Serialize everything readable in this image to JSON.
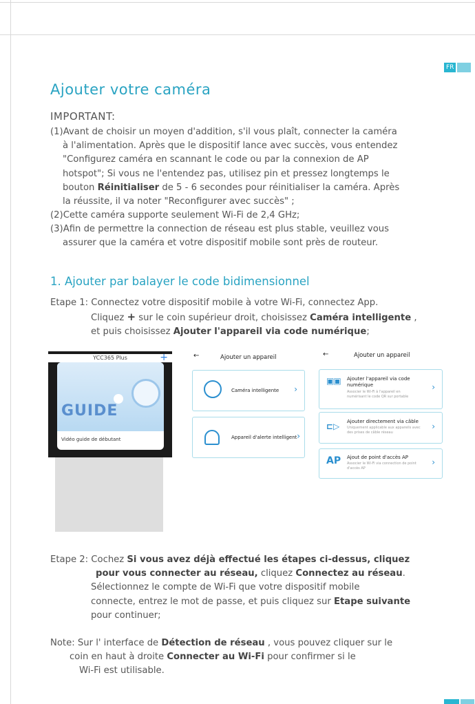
{
  "lang_badge": "FR",
  "title": "Ajouter votre caméra",
  "important_label": "IMPORTANT:",
  "items": {
    "i1": {
      "num": "(1)",
      "line1": "Avant de choisir un moyen d'addition, s'il vous plaît, connecter la caméra",
      "line2": "à l'alimentation. Après que le dispositif lance avec succès, vous entendez",
      "line3": "\"Configurez caméra en scannant le code ou par la connexion de AP",
      "line4": "hotspot\"; Si vous ne l'entendez pas, utilisez pin et pressez longtemps le",
      "line5_a": "bouton ",
      "line5_b": "Réinitialiser",
      "line5_c": " de 5 - 6 secondes pour réinitialiser la caméra. Après",
      "line6": "la réussite, il va noter \"Reconfigurer avec succès\" ;"
    },
    "i2": {
      "num": "(2)",
      "text": "Cette caméra supporte seulement Wi-Fi de 2,4 GHz;"
    },
    "i3": {
      "num": "(3)",
      "line1": "Afin de permettre la connection de réseau est plus stable, veuillez vous",
      "line2": "assurer que la caméra et votre dispositif mobile sont près de routeur."
    }
  },
  "section1_title": "1. Ajouter par balayer le code bidimensionnel",
  "step1": {
    "label": "Etape 1: ",
    "line1": "Connectez votre dispositif mobile à votre Wi-Fi, connectez App.",
    "line2_a": "Cliquez ",
    "line2_plus": "+",
    "line2_b": " sur le coin supérieur droit, choisissez ",
    "line2_c": "Caméra intelligente",
    "line2_d": " ,",
    "line3_a": "et puis choisissez ",
    "line3_b": "Ajouter l'appareil via code numérique",
    "line3_c": ";"
  },
  "screen1": {
    "app_name": "YCC365 Plus",
    "plus": "+",
    "guide_word": "GUIDE",
    "video_label": "Vidéo guide de débutant"
  },
  "screen2": {
    "back": "←",
    "title": "Ajouter un appareil",
    "options": [
      "Caméra intelligente",
      "Appareil d'alerte intelligent"
    ],
    "chevron": "›"
  },
  "screen3": {
    "back": "←",
    "title": "Ajouter un appareil",
    "options": [
      {
        "title_l1": "Ajouter l'appareil via code",
        "title_l2": "numérique",
        "sub_l1": "Associer le Wi-Fi à l'appareil en",
        "sub_l2": "numérisant le code QR sur portable"
      },
      {
        "title_l1": "Ajouter directement via câble",
        "title_l2": "",
        "sub_l1": "Uniquement applicable aux appareils avec",
        "sub_l2": "des prises de câble réseau"
      },
      {
        "title_l1": "Ajout de point d'accès AP",
        "title_l2": "",
        "sub_l1": "Associer le Wi-Fi via connection de point",
        "sub_l2": "d'accès AP"
      }
    ],
    "ap_icon_text": "AP",
    "chevron": "›"
  },
  "step2": {
    "label": "Etape 2: ",
    "line1_a": "Cochez ",
    "line1_b": "Si vous avez déjà effectué les étapes ci-dessus, cliquez",
    "line2_a": "pour vous connecter au réseau,",
    "line2_b": " cliquez ",
    "line2_c": "Connectez au réseau",
    "line2_d": ".",
    "line3": "Sélectionnez le compte de Wi-Fi que votre dispositif mobile",
    "line4_a": "connecte, entrez le mot de passe, et puis cliquez sur ",
    "line4_b": "Etape suivante",
    "line5": "pour continuer;"
  },
  "note": {
    "label": "Note: ",
    "line1_a": "Sur l' interface de ",
    "line1_b": "Détection de réseau",
    "line1_c": " , vous pouvez cliquer sur le",
    "line2_a": "coin en haut à droite ",
    "line2_b": "Connecter au Wi-Fi",
    "line2_c": " pour confirmer si le",
    "line3": "Wi-Fi est utilisable."
  }
}
